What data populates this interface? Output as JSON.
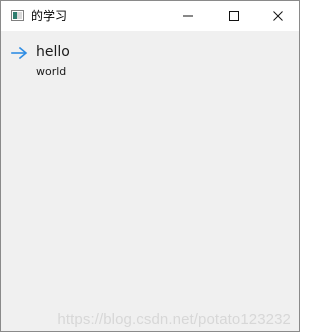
{
  "window": {
    "title": "的学习",
    "controls": {
      "minimize_icon": "minimize-icon",
      "maximize_icon": "maximize-icon",
      "close_icon": "close-icon"
    }
  },
  "content": {
    "item": {
      "title": "hello",
      "subtitle": "world",
      "icon": "arrow-right-icon",
      "icon_color": "#2f8de4"
    }
  },
  "watermark": "https://blog.csdn.net/potato123232"
}
